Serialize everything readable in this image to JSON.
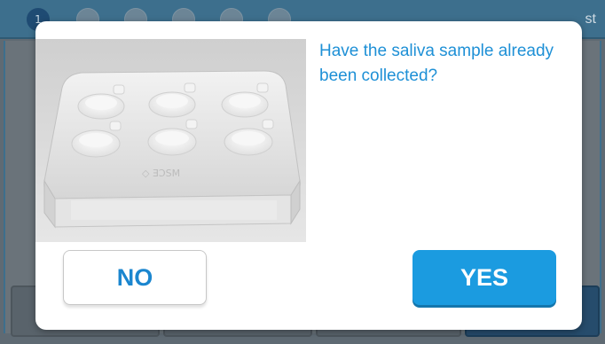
{
  "background": {
    "active_step": "1",
    "topbar_right_text": "st"
  },
  "dialog": {
    "question": "Have the saliva sample already been collected?",
    "no_label": "NO",
    "yes_label": "YES",
    "image_subject": "saliva-collection-tray"
  },
  "colors": {
    "accent": "#1b9be0",
    "question_text": "#1e90d6",
    "topbar": "#3d6f8d"
  }
}
